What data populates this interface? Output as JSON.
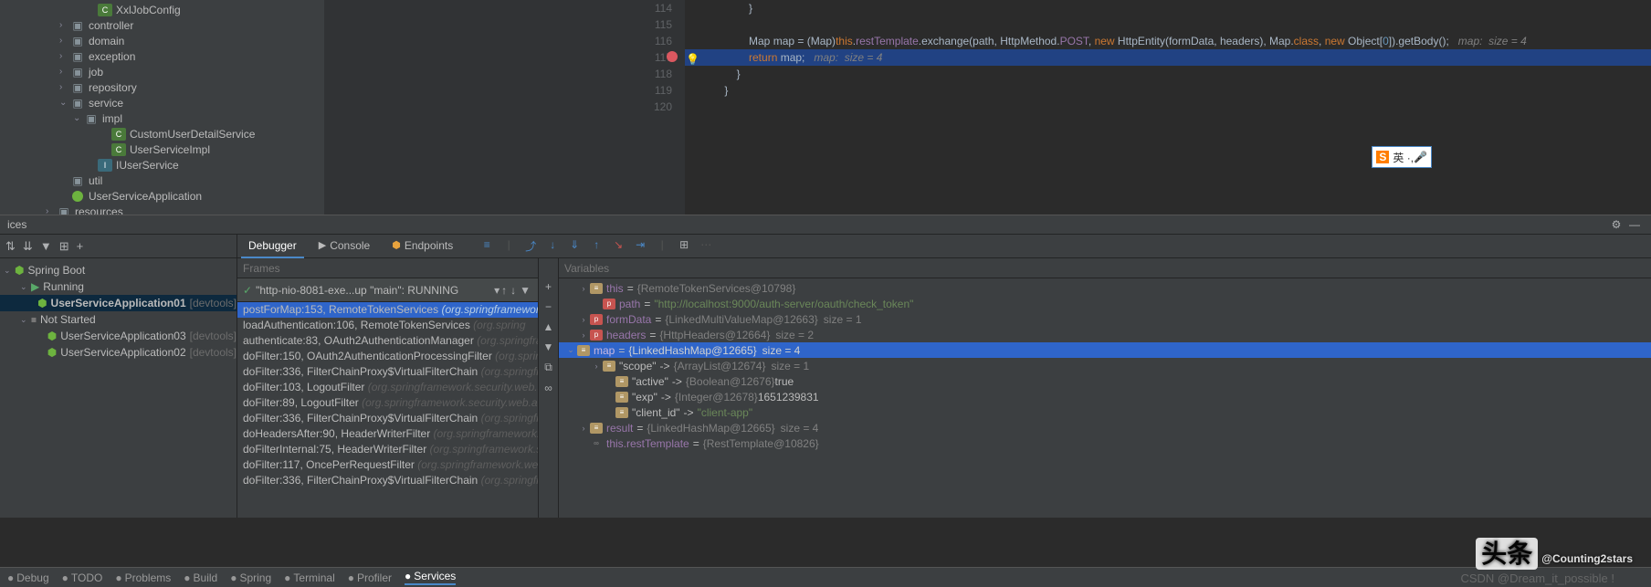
{
  "project_tree": [
    {
      "indent": 95,
      "arrow": "",
      "icon": "class",
      "label": "XxlJobConfig"
    },
    {
      "indent": 65,
      "arrow": "›",
      "icon": "folder",
      "label": "controller"
    },
    {
      "indent": 65,
      "arrow": "›",
      "icon": "folder",
      "label": "domain"
    },
    {
      "indent": 65,
      "arrow": "›",
      "icon": "folder",
      "label": "exception"
    },
    {
      "indent": 65,
      "arrow": "›",
      "icon": "folder",
      "label": "job"
    },
    {
      "indent": 65,
      "arrow": "›",
      "icon": "folder",
      "label": "repository"
    },
    {
      "indent": 65,
      "arrow": "⌄",
      "icon": "folder",
      "label": "service"
    },
    {
      "indent": 80,
      "arrow": "⌄",
      "icon": "folder",
      "label": "impl"
    },
    {
      "indent": 110,
      "arrow": "",
      "icon": "class",
      "label": "CustomUserDetailService"
    },
    {
      "indent": 110,
      "arrow": "",
      "icon": "class",
      "label": "UserServiceImpl"
    },
    {
      "indent": 95,
      "arrow": "",
      "icon": "iface",
      "label": "IUserService"
    },
    {
      "indent": 65,
      "arrow": "",
      "icon": "folder",
      "label": "util"
    },
    {
      "indent": 65,
      "arrow": "",
      "icon": "spring",
      "label": "UserServiceApplication"
    },
    {
      "indent": 50,
      "arrow": "›",
      "icon": "folder",
      "label": "resources"
    }
  ],
  "gutter_lines": [
    "114",
    "115",
    "116",
    "117",
    "118",
    "119",
    "120"
  ],
  "code": {
    "l116": {
      "pad": "            ",
      "t1": "Map map = (Map)",
      "t2": "this",
      "t3": ".",
      "t4": "restTemplate",
      "t5": ".exchange(path, HttpMethod.",
      "t6": "POST",
      "t7": ", ",
      "t8": "new",
      "t9": " HttpEntity(formData, headers), Map.",
      "t10": "class",
      "t11": ", ",
      "t12": "new",
      "t13": " Object[",
      "t14": "0",
      "t15": "]).getBody();   ",
      "cmt": "map:  size = 4"
    },
    "l117": {
      "pad": "            ",
      "t1": "return",
      "t2": " map;   ",
      "cmt": "map:  size = 4"
    },
    "l114": "            }",
    "l118": "        }",
    "l119": "    }"
  },
  "tool_title": "ices",
  "svc_tree": [
    {
      "indent": 4,
      "arrow": "⌄",
      "icon": "spring",
      "label": "Spring Boot"
    },
    {
      "indent": 22,
      "arrow": "⌄",
      "icon": "run",
      "label": "Running"
    },
    {
      "indent": 40,
      "arrow": "",
      "icon": "spring",
      "label": "UserServiceApplication01",
      "dev": "[devtools]",
      "sel": true
    },
    {
      "indent": 22,
      "arrow": "⌄",
      "icon": "stop",
      "label": "Not Started"
    },
    {
      "indent": 40,
      "arrow": "",
      "icon": "spring",
      "label": "UserServiceApplication03",
      "dev": "[devtools]"
    },
    {
      "indent": 40,
      "arrow": "",
      "icon": "spring",
      "label": "UserServiceApplication02",
      "dev": "[devtools]"
    }
  ],
  "dbg_tabs": {
    "debugger": "Debugger",
    "console": "Console",
    "endpoints": "Endpoints"
  },
  "frames_title": "Frames",
  "vars_title": "Variables",
  "thread": "\"http-nio-8081-exe...up \"main\": RUNNING",
  "frames": [
    {
      "main": "postForMap:153, RemoteTokenServices",
      "pkg": "(org.springframework",
      "sel": true
    },
    {
      "main": "loadAuthentication:106, RemoteTokenServices",
      "pkg": "(org.spring"
    },
    {
      "main": "authenticate:83, OAuth2AuthenticationManager",
      "pkg": "(org.springfram"
    },
    {
      "main": "doFilter:150, OAuth2AuthenticationProcessingFilter",
      "pkg": "(org.spring"
    },
    {
      "main": "doFilter:336, FilterChainProxy$VirtualFilterChain",
      "pkg": "(org.springfram"
    },
    {
      "main": "doFilter:103, LogoutFilter",
      "pkg": "(org.springframework.security.web.au"
    },
    {
      "main": "doFilter:89, LogoutFilter",
      "pkg": "(org.springframework.security.web.aut"
    },
    {
      "main": "doFilter:336, FilterChainProxy$VirtualFilterChain",
      "pkg": "(org.springfram"
    },
    {
      "main": "doHeadersAfter:90, HeaderWriterFilter",
      "pkg": "(org.springframework.se"
    },
    {
      "main": "doFilterInternal:75, HeaderWriterFilter",
      "pkg": "(org.springframework.se"
    },
    {
      "main": "doFilter:117, OncePerRequestFilter",
      "pkg": "(org.springframework.web.fi"
    },
    {
      "main": "doFilter:336, FilterChainProxy$VirtualFilterChain",
      "pkg": "(org.springfram"
    }
  ],
  "vars": [
    {
      "indent": 20,
      "arrow": "›",
      "typ": "m",
      "name": "this",
      "eq": " = ",
      "obj": "{RemoteTokenServices@10798}"
    },
    {
      "indent": 34,
      "arrow": "",
      "typ": "p",
      "name": "path",
      "eq": " = ",
      "val": "\"http://localhost:9000/auth-server/oauth/check_token\""
    },
    {
      "indent": 20,
      "arrow": "›",
      "typ": "p",
      "name": "formData",
      "eq": " = ",
      "obj": "{LinkedMultiValueMap@12663}",
      "size": "size = 1"
    },
    {
      "indent": 20,
      "arrow": "›",
      "typ": "p",
      "name": "headers",
      "eq": " = ",
      "obj": "{HttpHeaders@12664}",
      "size": "size = 2"
    },
    {
      "indent": 6,
      "arrow": "⌄",
      "typ": "m",
      "name": "map",
      "eq": " = ",
      "obj": "{LinkedHashMap@12665}",
      "size": "size = 4",
      "sel": true
    },
    {
      "indent": 34,
      "arrow": "›",
      "typ": "m",
      "name": "\"scope\"",
      "eq": " -> ",
      "obj": "{ArrayList@12674}",
      "size": "size = 1",
      "key": true
    },
    {
      "indent": 48,
      "arrow": "",
      "typ": "m",
      "name": "\"active\"",
      "eq": " -> ",
      "obj": "{Boolean@12676}",
      "val2": "true",
      "key": true
    },
    {
      "indent": 48,
      "arrow": "",
      "typ": "m",
      "name": "\"exp\"",
      "eq": " -> ",
      "obj": "{Integer@12678}",
      "val2": "1651239831",
      "key": true
    },
    {
      "indent": 48,
      "arrow": "",
      "typ": "m",
      "name": "\"client_id\"",
      "eq": " -> ",
      "val": "\"client-app\"",
      "key": true
    },
    {
      "indent": 20,
      "arrow": "›",
      "typ": "m",
      "name": "result",
      "eq": " = ",
      "obj": "{LinkedHashMap@12665}",
      "size": "size = 4"
    },
    {
      "indent": 20,
      "arrow": "",
      "typ": "inf",
      "name": "this.restTemplate",
      "eq": " = ",
      "obj": "{RestTemplate@10826}",
      "inf": true
    }
  ],
  "watermark": "@Counting2stars",
  "watermark_logo": "头条",
  "watermark2": "CSDN @Dream_it_possible !",
  "ime": "英 ·, ",
  "bottom": [
    "Debug",
    "TODO",
    "Problems",
    "Build",
    "Spring",
    "Terminal",
    "Profiler",
    "Services"
  ]
}
